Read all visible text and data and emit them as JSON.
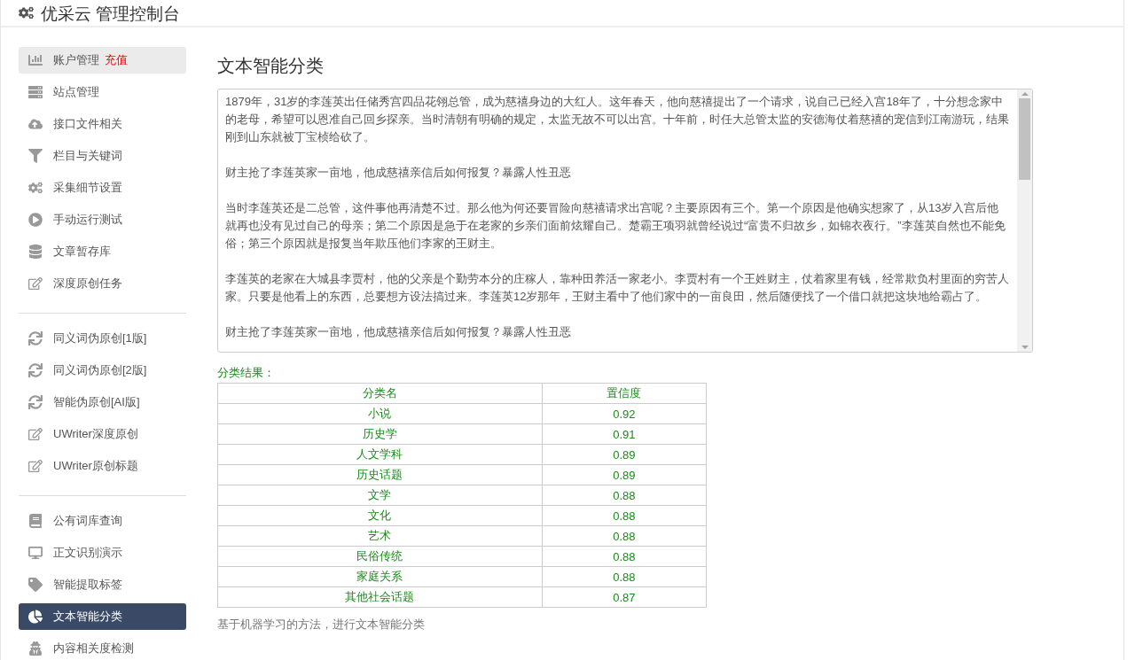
{
  "header": {
    "title": "优采云 管理控制台"
  },
  "sidebar": {
    "groups": [
      {
        "items": [
          {
            "label": "账户管理",
            "badge": "充值",
            "selected": false,
            "highlighted": true
          },
          {
            "label": "站点管理",
            "selected": false,
            "highlighted": false
          },
          {
            "label": "接口文件相关",
            "selected": false,
            "highlighted": false
          },
          {
            "label": "栏目与关键词",
            "selected": false,
            "highlighted": false
          },
          {
            "label": "采集细节设置",
            "selected": false,
            "highlighted": false
          },
          {
            "label": "手动运行测试",
            "selected": false,
            "highlighted": false
          },
          {
            "label": "文章暂存库",
            "selected": false,
            "highlighted": false
          },
          {
            "label": "深度原创任务",
            "selected": false,
            "highlighted": false
          }
        ]
      },
      {
        "items": [
          {
            "label": "同义词伪原创[1版]",
            "selected": false,
            "highlighted": false
          },
          {
            "label": "同义词伪原创[2版]",
            "selected": false,
            "highlighted": false
          },
          {
            "label": "智能伪原创[AI版]",
            "selected": false,
            "highlighted": false
          },
          {
            "label": "UWriter深度原创",
            "selected": false,
            "highlighted": false
          },
          {
            "label": "UWriter原创标题",
            "selected": false,
            "highlighted": false
          }
        ]
      },
      {
        "items": [
          {
            "label": "公有词库查询",
            "selected": false,
            "highlighted": false
          },
          {
            "label": "正文识别演示",
            "selected": false,
            "highlighted": false
          },
          {
            "label": "智能提取标签",
            "selected": false,
            "highlighted": false
          },
          {
            "label": "文本智能分类",
            "selected": true,
            "highlighted": false
          },
          {
            "label": "内容相关度检测",
            "selected": false,
            "highlighted": false
          }
        ]
      }
    ]
  },
  "main": {
    "title": "文本智能分类",
    "text_input": {
      "paragraphs": [
        "1879年，31岁的李莲英出任储秀宫四品花翎总管，成为慈禧身边的大红人。这年春天，他向慈禧提出了一个请求，说自己已经入宫18年了，十分想念家中的老母，希望可以恩准自己回乡探亲。当时清朝有明确的规定，太监无故不可以出宫。十年前，时任大总管太监的安德海仗着慈禧的宠信到江南游玩，结果刚到山东就被丁宝桢给砍了。",
        "财主抢了李莲英家一亩地，他成慈禧亲信后如何报复？暴露人性丑恶",
        "当时李莲英还是二总管，这件事他再清楚不过。那么他为何还要冒险向慈禧请求出宫呢？主要原因有三个。第一个原因是他确实想家了，从13岁入宫后他就再也没有见过自己的母亲；第二个原因是急于在老家的乡亲们面前炫耀自己。楚霸王项羽就曾经说过“富贵不归故乡，如锦衣夜行。”李莲英自然也不能免俗；第三个原因就是报复当年欺压他们李家的王财主。",
        "李莲英的老家在大城县李贾村，他的父亲是个勤劳本分的庄稼人，靠种田养活一家老小。李贾村有一个王姓财主，仗着家里有钱，经常欺负村里面的穷苦人家。只要是他看上的东西，总要想方设法搞过来。李莲英12岁那年，王财主看中了他们家中的一亩良田，然后随便找了一个借口就把这块地给霸占了。",
        "财主抢了李莲英家一亩地，他成慈禧亲信后如何报复？暴露人性丑恶"
      ]
    },
    "result_label": "分类结果：",
    "table": {
      "columns": [
        "分类名",
        "置信度"
      ],
      "rows": [
        [
          "小说",
          "0.92"
        ],
        [
          "历史学",
          "0.91"
        ],
        [
          "人文学科",
          "0.89"
        ],
        [
          "历史话题",
          "0.89"
        ],
        [
          "文学",
          "0.88"
        ],
        [
          "文化",
          "0.88"
        ],
        [
          "艺术",
          "0.88"
        ],
        [
          "民俗传统",
          "0.88"
        ],
        [
          "家庭关系",
          "0.88"
        ],
        [
          "其他社会话题",
          "0.87"
        ]
      ]
    },
    "footer_note": "基于机器学习的方法，进行文本智能分类"
  }
}
